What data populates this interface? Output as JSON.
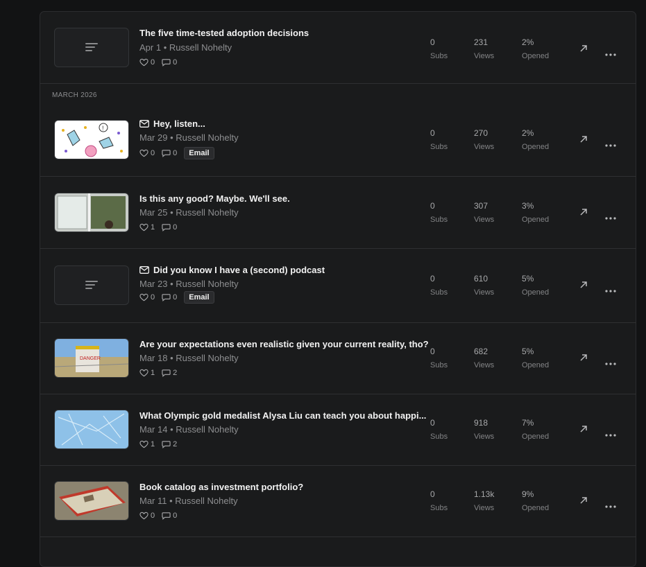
{
  "section": {
    "label": "MARCH 2026"
  },
  "posts": [
    {
      "title": "The five time-tested adoption decisions",
      "has_mail_icon": false,
      "date": "Apr 1",
      "author": "Russell Nohelty",
      "likes": "0",
      "comments": "0",
      "badge": "",
      "subs": "0",
      "subs_label": "Subs",
      "views": "231",
      "views_label": "Views",
      "opened": "2%",
      "opened_label": "Opened",
      "thumbnail": "placeholder"
    },
    {
      "title": "Hey, listen...",
      "has_mail_icon": true,
      "date": "Mar 29",
      "author": "Russell Nohelty",
      "likes": "0",
      "comments": "0",
      "badge": "Email",
      "subs": "0",
      "subs_label": "Subs",
      "views": "270",
      "views_label": "Views",
      "opened": "2%",
      "opened_label": "Opened",
      "thumbnail": "doodle"
    },
    {
      "title": "Is this any good? Maybe. We'll see.",
      "has_mail_icon": false,
      "date": "Mar 25",
      "author": "Russell Nohelty",
      "likes": "1",
      "comments": "0",
      "badge": "",
      "subs": "0",
      "subs_label": "Subs",
      "views": "307",
      "views_label": "Views",
      "opened": "3%",
      "opened_label": "Opened",
      "thumbnail": "window"
    },
    {
      "title": "Did you know I have a (second) podcast",
      "has_mail_icon": true,
      "date": "Mar 23",
      "author": "Russell Nohelty",
      "likes": "0",
      "comments": "0",
      "badge": "Email",
      "subs": "0",
      "subs_label": "Subs",
      "views": "610",
      "views_label": "Views",
      "opened": "5%",
      "opened_label": "Opened",
      "thumbnail": "placeholder"
    },
    {
      "title": "Are your expectations even realistic given your current reality, tho?",
      "has_mail_icon": false,
      "date": "Mar 18",
      "author": "Russell Nohelty",
      "likes": "1",
      "comments": "2",
      "badge": "",
      "subs": "0",
      "subs_label": "Subs",
      "views": "682",
      "views_label": "Views",
      "opened": "5%",
      "opened_label": "Opened",
      "thumbnail": "road-sign"
    },
    {
      "title": "What Olympic gold medalist Alysa Liu can teach you about happi...",
      "has_mail_icon": false,
      "date": "Mar 14",
      "author": "Russell Nohelty",
      "likes": "1",
      "comments": "2",
      "badge": "",
      "subs": "0",
      "subs_label": "Subs",
      "views": "918",
      "views_label": "Views",
      "opened": "7%",
      "opened_label": "Opened",
      "thumbnail": "ice"
    },
    {
      "title": "Book catalog as investment portfolio?",
      "has_mail_icon": false,
      "date": "Mar 11",
      "author": "Russell Nohelty",
      "likes": "0",
      "comments": "0",
      "badge": "",
      "subs": "0",
      "subs_label": "Subs",
      "views": "1.13k",
      "views_label": "Views",
      "opened": "9%",
      "opened_label": "Opened",
      "thumbnail": "book"
    }
  ],
  "separator": " • ",
  "icons": {
    "like": "heart-icon",
    "comment": "comment-icon",
    "mail": "mail-icon",
    "open": "arrow-up-right-icon",
    "more": "more-horizontal-icon"
  },
  "colors": {
    "background": "#121314",
    "panel": "#1a1b1c",
    "border": "#2f3032",
    "text": "#f2f2f2",
    "muted": "#8e8f91"
  }
}
